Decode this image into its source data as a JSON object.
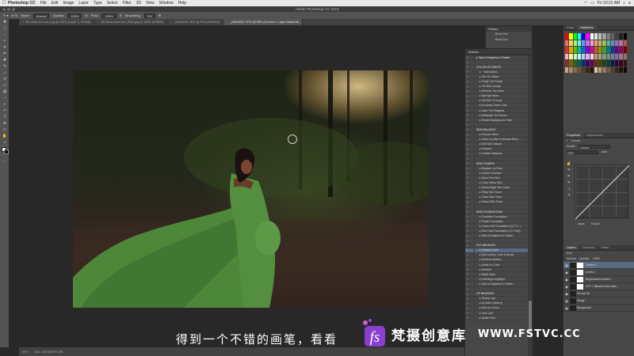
{
  "menubar": {
    "app": "Photoshop CC",
    "items": [
      "File",
      "Edit",
      "Image",
      "Layer",
      "Type",
      "Select",
      "Filter",
      "3D",
      "View",
      "Window",
      "Help"
    ],
    "clock": "Fri 10:21 AM"
  },
  "window": {
    "title": "Adobe Photoshop CC 2018"
  },
  "options": {
    "mode_label": "Mode:",
    "mode": "Normal",
    "opacity_label": "Opacity:",
    "opacity": "100%",
    "flow_label": "Flow:",
    "flow": "100%",
    "smoothing_label": "Smoothing:",
    "smoothing": "0%"
  },
  "tabs": [
    {
      "label": "RE-white-box-me.png @ 100% (Layer 0, RGB/8)"
    },
    {
      "label": "RE-Blush-bkm-me_PNG.jpg @ 100% (RGB/8)"
    },
    {
      "label": "_MHA3181.JPG @ 50% (RGB/16)"
    },
    {
      "label": "_MHA3317.JPG @ 50% (Curves 1, Layer Mask/16)"
    }
  ],
  "toolbar": {
    "icons": [
      "move-icon",
      "marquee-icon",
      "lasso-icon",
      "quick-select-icon",
      "crop-icon",
      "eyedropper-icon",
      "healing-icon",
      "brush-icon",
      "clone-stamp-icon",
      "history-brush-icon",
      "eraser-icon",
      "gradient-icon",
      "blur-icon",
      "dodge-icon",
      "pen-icon",
      "type-icon",
      "path-select-icon",
      "rectangle-icon",
      "hand-icon",
      "zoom-icon",
      "more-tools-icon"
    ]
  },
  "history": {
    "title": "History",
    "items": [
      "_MHA3317.JPG",
      "Brush Tool",
      "Brush Tool"
    ]
  },
  "actions": {
    "title": "Actions",
    "rows": [
      {
        "type": "set",
        "label": "▸ Take A Snapshot & Flatten"
      },
      {
        "type": "set",
        "label": ""
      },
      {
        "type": "set",
        "label": "COLOR ITS PAINTS"
      },
      {
        "type": "item",
        "label": "▸ ~ Instructions"
      },
      {
        "type": "item",
        "label": "▸ You Go Yellow"
      },
      {
        "type": "item",
        "label": "▸ Purge The Purple"
      },
      {
        "type": "item",
        "label": "▸ Off With Orange"
      },
      {
        "type": "item",
        "label": "▸ Remove The Reds"
      },
      {
        "type": "item",
        "label": "▸ Bye Bye Blues"
      },
      {
        "type": "item",
        "label": "▸ Get Rid Of Greys"
      },
      {
        "type": "item",
        "label": "▸ Go Away Green Cast"
      },
      {
        "type": "item",
        "label": "▸ Later The Magenta"
      },
      {
        "type": "item",
        "label": "▸ Obliterate The Brown"
      },
      {
        "type": "item",
        "label": "▸ Rusted Background Paint"
      },
      {
        "type": "set",
        "label": ""
      },
      {
        "type": "set",
        "label": "SKIN BALANCE"
      },
      {
        "type": "item",
        "label": "▸ Reduce Shine"
      },
      {
        "type": "item",
        "label": "▸ Clean Up Skin & Minimal Blem..."
      },
      {
        "type": "item",
        "label": "▸ Soft Skin Natural"
      },
      {
        "type": "item",
        "label": "▸ Sharpen"
      },
      {
        "type": "item",
        "label": "▸ Freckle Fabulous"
      },
      {
        "type": "set",
        "label": ""
      },
      {
        "type": "set",
        "label": "SKIN TONERS"
      },
      {
        "type": "item",
        "label": "▸ Brighten Up Face"
      },
      {
        "type": "item",
        "label": "▸ Correct Contrast"
      },
      {
        "type": "item",
        "label": "▸ Warm The Skin"
      },
      {
        "type": "item",
        "label": "▸ Color Yellow Skin"
      },
      {
        "type": "item",
        "label": "▸ Warm Bright Skin Toner"
      },
      {
        "type": "item",
        "label": "▸ Pinky Skin Toner"
      },
      {
        "type": "item",
        "label": "▸ Clean Skin Toner"
      },
      {
        "type": "item",
        "label": "▸ Yellow Skin Toner"
      },
      {
        "type": "set",
        "label": ""
      },
      {
        "type": "set",
        "label": "SKIN FOUNDATIONS"
      },
      {
        "type": "item",
        "label": "▸ Porcelain Foundation"
      },
      {
        "type": "item",
        "label": "▸ Peach Foundation"
      },
      {
        "type": "item",
        "label": "▸ Cream Soft Foundation (CC O...)"
      },
      {
        "type": "item",
        "label": "▸ Rich Dark Foundation (CC Only)"
      },
      {
        "type": "item",
        "label": "▸ Take A Snapshot & Flatten"
      },
      {
        "type": "set",
        "label": ""
      },
      {
        "type": "set",
        "label": "EYE BRUSHES"
      },
      {
        "type": "item",
        "label": "▸ Sharpen Eyes",
        "selected": true
      },
      {
        "type": "item",
        "label": "▸ Eye Lashes, Liner & Brows"
      },
      {
        "type": "item",
        "label": "▸ Eyebrow Darken"
      },
      {
        "type": "item",
        "label": "▸ Jewel It's Color"
      },
      {
        "type": "item",
        "label": "▸ Glimmer"
      },
      {
        "type": "item",
        "label": "▸ Bright Eyes"
      },
      {
        "type": "item",
        "label": "▸ Catchlight Highlight"
      },
      {
        "type": "item",
        "label": "▸ Take A Snapshot & Flatten"
      },
      {
        "type": "set",
        "label": ""
      },
      {
        "type": "set",
        "label": "LIP BRUSHES"
      },
      {
        "type": "item",
        "label": "▸ Glossy Lips"
      },
      {
        "type": "item",
        "label": "▸ Lip Balm (Soften)"
      },
      {
        "type": "item",
        "label": "▸ Add Lip Colour"
      },
      {
        "type": "item",
        "label": "▸ Tone Lips"
      },
      {
        "type": "item",
        "label": "▸ Bolder Red"
      }
    ]
  },
  "swatches": {
    "tabs": [
      "Color",
      "Swatches"
    ],
    "colors": [
      "#ff0000",
      "#ffff00",
      "#00ff00",
      "#00ffff",
      "#0000ff",
      "#ff00ff",
      "#ffffff",
      "#e0e0e0",
      "#c0c0c0",
      "#a0a0a0",
      "#808080",
      "#606060",
      "#404040",
      "#202020",
      "#000000",
      "#ff6666",
      "#ffcc66",
      "#99ff66",
      "#66ffcc",
      "#6699ff",
      "#cc66ff",
      "#ff99cc",
      "#f0a070",
      "#d0b060",
      "#90c060",
      "#60b090",
      "#6090c0",
      "#9070c0",
      "#c070a0",
      "#c05050",
      "#e03030",
      "#f0a000",
      "#60c000",
      "#00c0a0",
      "#0070e0",
      "#8000e0",
      "#e000a0",
      "#c06020",
      "#a09000",
      "#40a040",
      "#008080",
      "#004090",
      "#600090",
      "#900060",
      "#800000",
      "#ffb0b0",
      "#fff0a0",
      "#c0ffb0",
      "#b0fff0",
      "#b0d0ff",
      "#e0b0ff",
      "#ffd0e8",
      "#d09070",
      "#b0a070",
      "#80a070",
      "#709090",
      "#7080a0",
      "#8070a0",
      "#a07090",
      "#907070",
      "#803030",
      "#806000",
      "#306020",
      "#006050",
      "#003070",
      "#400070",
      "#700040",
      "#603010",
      "#504000",
      "#204020",
      "#004040",
      "#002040",
      "#300040",
      "#400020",
      "#301010",
      "#c8a882",
      "#a58a6a",
      "#8a6e50",
      "#6e5338",
      "#533a24",
      "#3a2616",
      "#241408",
      "#d8c0a0",
      "#b89878",
      "#987858",
      "#785840",
      "#584028",
      "#382818",
      "#201408",
      "#100804"
    ]
  },
  "properties": {
    "tabs": [
      "Properties",
      "Adjustments"
    ],
    "adjustment": "Curves",
    "preset_label": "Preset:",
    "preset": "Custom",
    "channel": "RGB",
    "auto_label": "Auto",
    "input_label": "Input:",
    "output_label": "Output:",
    "input": "",
    "output": ""
  },
  "layers": {
    "tabs": [
      "Layers",
      "Channels",
      "Paths"
    ],
    "kind_label": "Kind",
    "blend": "Normal",
    "opacity_label": "Opacity:",
    "opacity": "100%",
    "rows": [
      {
        "name": "Curves 1",
        "mask": true,
        "selected": true
      },
      {
        "name": "Levels 1",
        "mask": true
      },
      {
        "name": "Brightness/Contrast 1",
        "mask": true
      },
      {
        "name": "CPF + Blended Skin (with...",
        "mask": true
      },
      {
        "name": "Re-edit 3D"
      },
      {
        "name": "Merge"
      },
      {
        "name": "Background"
      }
    ]
  },
  "status": {
    "zoom": "50%",
    "doc": "Doc: 130.9M/275.2M"
  },
  "overlay": {
    "subtitle": "得到一个不错的画笔，看看",
    "watermark_text": "梵摄创意库",
    "watermark_url": "WWW.FSTVC.CC"
  },
  "colors": {
    "dress": "#4f8c3c",
    "accent_selected": "#5a6a85"
  }
}
